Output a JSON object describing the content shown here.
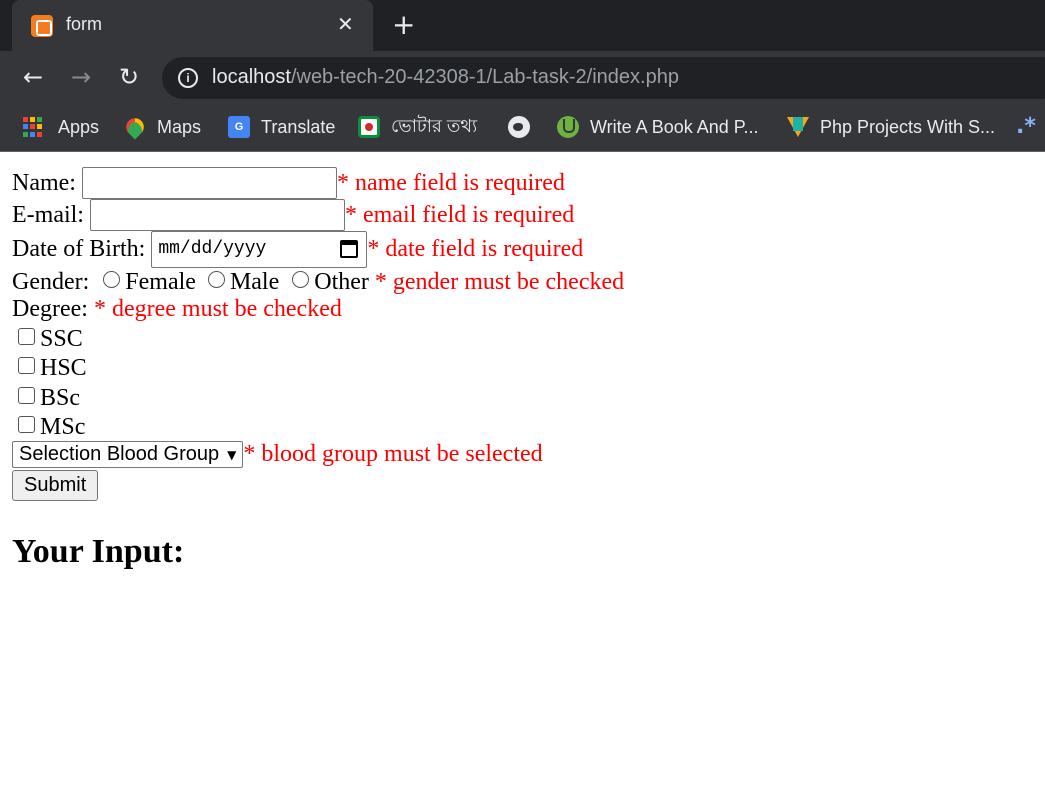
{
  "browser": {
    "tab_title": "form",
    "url_host": "localhost",
    "url_path": "/web-tech-20-42308-1/Lab-task-2/index.php",
    "bookmarks": [
      {
        "label": "Apps",
        "icon": "apps-grid-icon"
      },
      {
        "label": "Maps",
        "icon": "google-maps-icon"
      },
      {
        "label": "Translate",
        "icon": "google-translate-icon"
      },
      {
        "label": "ভোটার তথ্য",
        "icon": "voter-info-icon"
      },
      {
        "label": "",
        "icon": "globe-icon"
      },
      {
        "label": "Write A Book And P...",
        "icon": "write-book-icon"
      },
      {
        "label": "Php Projects With S...",
        "icon": "php-projects-icon"
      }
    ]
  },
  "form": {
    "name_label": "Name:",
    "name_value": "",
    "name_error": "* name field is required",
    "email_label": "E-mail:",
    "email_value": "",
    "email_error": "* email field is required",
    "dob_label": "Date of Birth:",
    "dob_placeholder": "mm/dd/yyyy",
    "dob_error": "* date field is required",
    "gender_label": "Gender:",
    "gender_options": [
      "Female",
      "Male",
      "Other"
    ],
    "gender_error": "* gender must be checked",
    "degree_label": "Degree:",
    "degree_error": "* degree must be checked",
    "degree_options": [
      "SSC",
      "HSC",
      "BSc",
      "MSc"
    ],
    "blood_group_selected": "Selection Blood Group",
    "blood_group_error": "* blood group must be selected",
    "submit_label": "Submit"
  },
  "output": {
    "heading": "Your Input:"
  },
  "colors": {
    "error": "#ff0000",
    "chrome_dark": "#202124",
    "chrome_toolbar": "#35363a"
  }
}
